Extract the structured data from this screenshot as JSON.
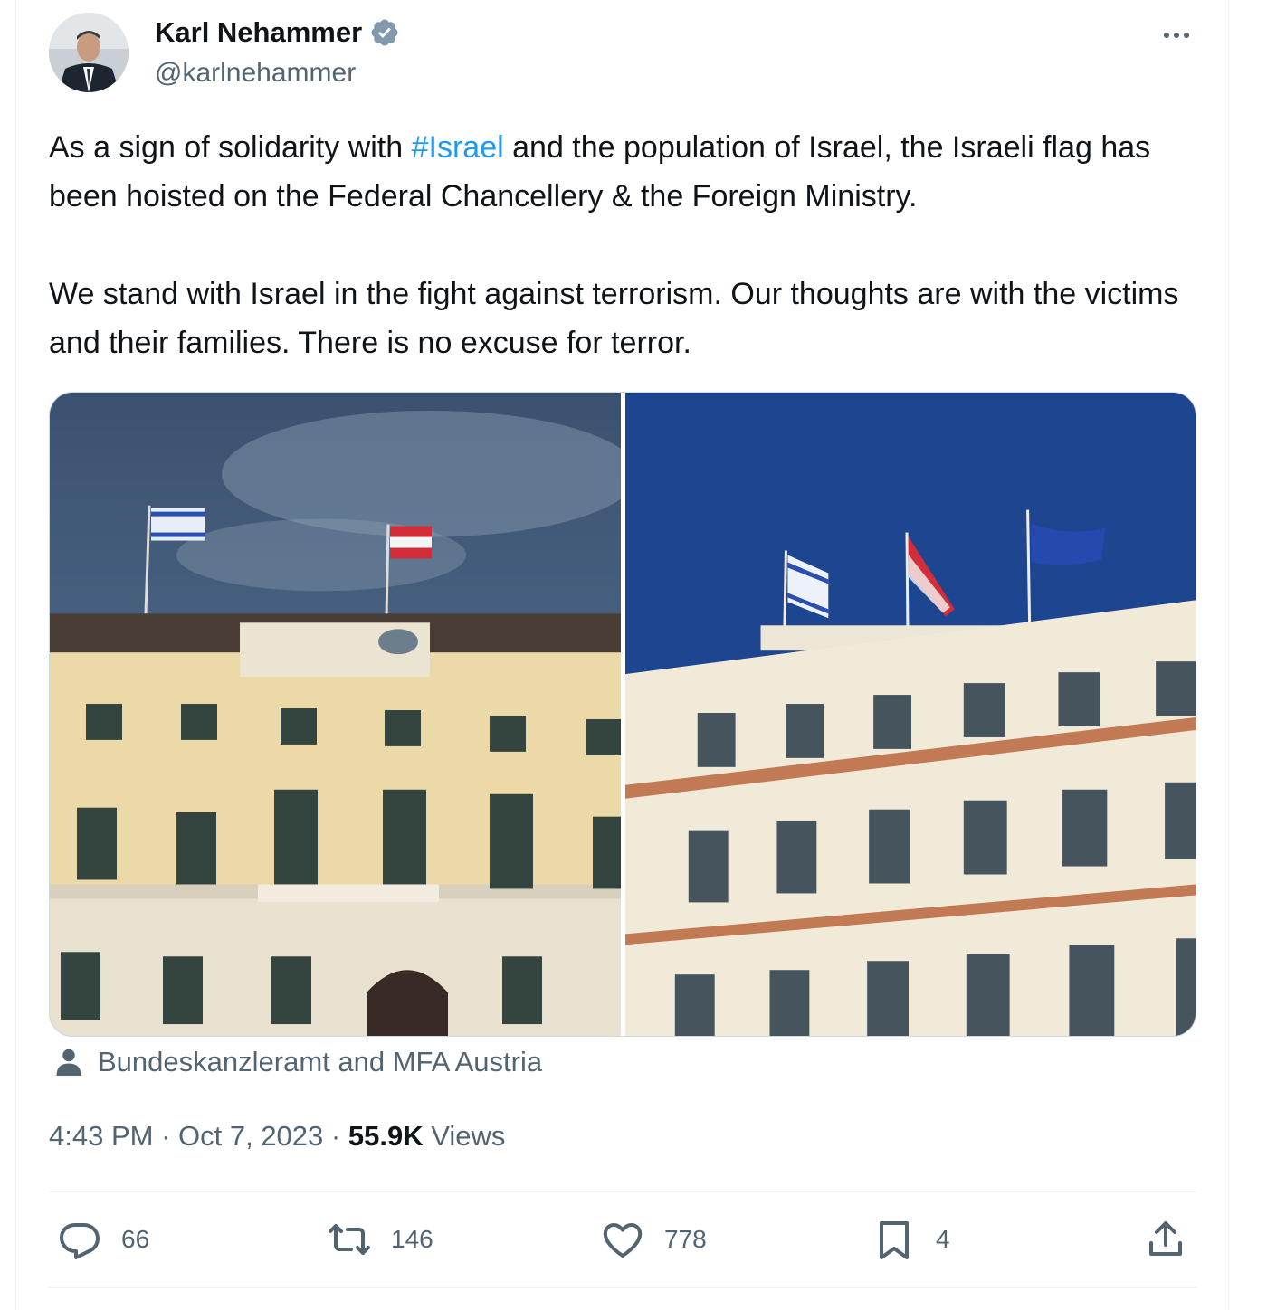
{
  "author": {
    "name": "Karl Nehammer",
    "handle": "@karlnehammer",
    "verified": true
  },
  "tweet": {
    "paragraph1_before": "As a sign of solidarity with ",
    "hashtag": "#Israel",
    "paragraph1_after": " and the population of Israel, the Israeli flag has been hoisted on the Federal Chancellery & the Foreign Ministry.",
    "paragraph2": "We stand with Israel in the fight against terrorism. Our thoughts are with the victims and their families. There is no excuse for terror."
  },
  "tagged": "Bundeskanzleramt and MFA Austria",
  "meta": {
    "time": "4:43 PM",
    "sep": " · ",
    "date": "Oct 7, 2023",
    "views_count": "55.9K",
    "views_label": " Views"
  },
  "actions": {
    "replies": "66",
    "reposts": "146",
    "likes": "778",
    "bookmarks": "4"
  },
  "colors": {
    "link": "#1d9bf0",
    "secondary_text": "#536471",
    "primary_text": "#0f1419",
    "border": "#eff3f4"
  },
  "icons": [
    "verified-badge-icon",
    "more-icon",
    "person-icon",
    "reply-icon",
    "repost-icon",
    "like-icon",
    "bookmark-icon",
    "share-icon"
  ]
}
